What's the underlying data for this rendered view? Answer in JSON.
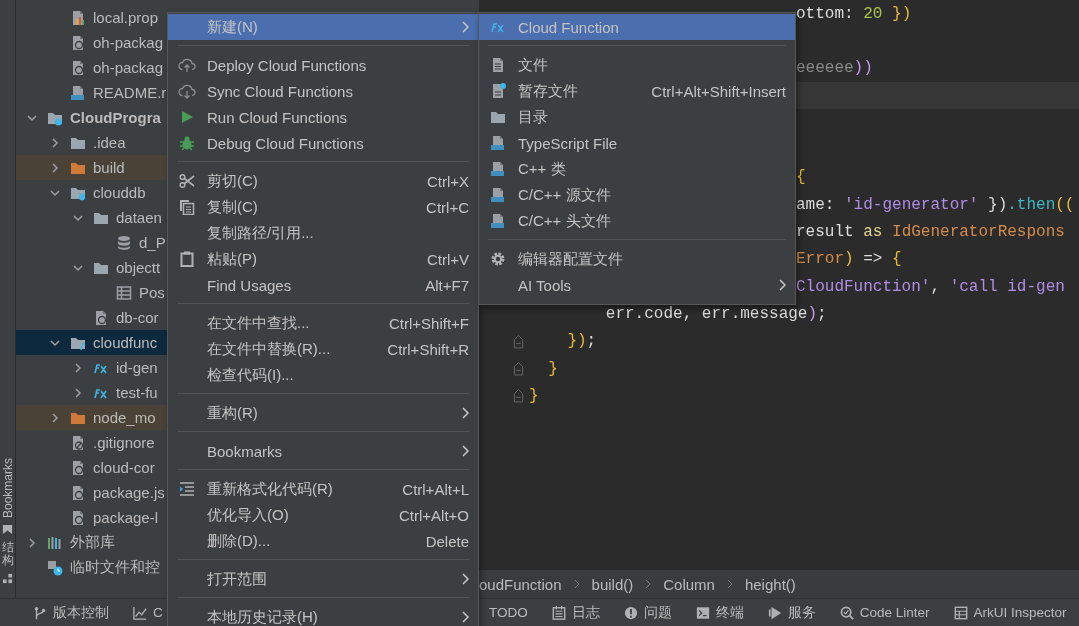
{
  "side_stripe": {
    "labels": [
      "Bookmarks",
      "结构"
    ]
  },
  "project_tree": {
    "leading_items": [
      {
        "label": "local.prop",
        "kind": "chart-file",
        "selected": false,
        "excluded": false
      },
      {
        "label": "oh-packag",
        "kind": "json-file",
        "selected": false,
        "excluded": false
      },
      {
        "label": "oh-packag",
        "kind": "json-file",
        "selected": false,
        "excluded": false
      },
      {
        "label": "README.r",
        "kind": "md-file",
        "selected": false,
        "excluded": false
      }
    ],
    "items": [
      {
        "label": "CloudProgra",
        "kind": "module",
        "expanded": true,
        "selected": false,
        "excluded": false,
        "children": [
          {
            "label": ".idea",
            "kind": "folder",
            "expanded": false,
            "selected": false,
            "excluded": false
          },
          {
            "label": "build",
            "kind": "folder",
            "expanded": false,
            "selected": false,
            "excluded": true
          },
          {
            "label": "clouddb",
            "kind": "db-folder",
            "expanded": true,
            "selected": false,
            "excluded": false,
            "children": [
              {
                "label": "dataen",
                "kind": "folder",
                "expanded": true,
                "selected": false,
                "excluded": false,
                "children": [
                  {
                    "label": "d_P",
                    "kind": "database",
                    "selected": false,
                    "excluded": false
                  }
                ]
              },
              {
                "label": "objectt",
                "kind": "folder",
                "expanded": true,
                "selected": false,
                "excluded": false,
                "children": [
                  {
                    "label": "Pos",
                    "kind": "table",
                    "selected": false,
                    "excluded": false
                  }
                ]
              },
              {
                "label": "db-cor",
                "kind": "json-file",
                "selected": false,
                "excluded": false
              }
            ]
          },
          {
            "label": "cloudfunc",
            "kind": "fn-folder",
            "expanded": true,
            "selected": true,
            "excluded": false,
            "children": [
              {
                "label": "id-gen",
                "kind": "function",
                "expanded": false,
                "selected": false,
                "excluded": false
              },
              {
                "label": "test-fu",
                "kind": "function",
                "expanded": false,
                "selected": false,
                "excluded": false
              }
            ]
          },
          {
            "label": "node_mo",
            "kind": "folder",
            "expanded": false,
            "selected": false,
            "excluded": true
          },
          {
            "label": ".gitignore",
            "kind": "ignore-file",
            "selected": false,
            "excluded": false
          },
          {
            "label": "cloud-cor",
            "kind": "json-file",
            "selected": false,
            "excluded": false
          },
          {
            "label": "package.js",
            "kind": "json-file",
            "selected": false,
            "excluded": false
          },
          {
            "label": "package-l",
            "kind": "json-file",
            "selected": false,
            "excluded": false
          }
        ]
      },
      {
        "label": "外部库",
        "kind": "library",
        "expanded": false,
        "selected": false,
        "excluded": false
      },
      {
        "label": "临时文件和控",
        "kind": "scratch",
        "selected": false,
        "excluded": false
      }
    ]
  },
  "editor": {
    "lines": [
      {
        "kind": "code",
        "cut": true,
        "tokens": [
          {
            "text": "ottom: ",
            "kind": "plain"
          },
          {
            "text": "20",
            "kind": "number"
          },
          {
            "text": " })",
            "kind": "bracket"
          }
        ]
      },
      {
        "kind": "code"
      },
      {
        "kind": "code",
        "cut": true,
        "tokens": [
          {
            "text": "eeeeee",
            "kind": "muted"
          },
          {
            "text": "))",
            "kind": "paren"
          }
        ]
      },
      {
        "kind": "current-line"
      },
      {
        "kind": "code"
      },
      {
        "kind": "code"
      },
      {
        "kind": "code",
        "cut": true,
        "tokens": [
          {
            "text": "{",
            "kind": "bracket"
          }
        ]
      },
      {
        "kind": "code",
        "cut": true,
        "tokens": [
          {
            "text": "ame: ",
            "kind": "plain"
          },
          {
            "text": "'id-generator'",
            "kind": "string"
          },
          {
            "text": " })",
            "kind": "plain"
          },
          {
            "text": ".then",
            "kind": "method"
          },
          {
            "text": "((",
            "kind": "bracket"
          }
        ]
      },
      {
        "kind": "code",
        "cut": true,
        "tokens": [
          {
            "text": "result ",
            "kind": "plain"
          },
          {
            "text": "as",
            "kind": "keyword"
          },
          {
            "text": " IdGeneratorRespons",
            "kind": "type"
          }
        ]
      },
      {
        "kind": "code",
        "cut": true,
        "tokens": [
          {
            "text": "Error",
            "kind": "type"
          },
          {
            "text": ")",
            "kind": "bracket"
          },
          {
            "text": " => ",
            "kind": "plain"
          },
          {
            "text": "{",
            "kind": "bracket"
          }
        ]
      },
      {
        "kind": "code",
        "cut": true,
        "tokens": [
          {
            "text": "CloudFunction'",
            "kind": "string"
          },
          {
            "text": ", ",
            "kind": "plain"
          },
          {
            "text": "'call id-gen",
            "kind": "string"
          }
        ]
      },
      {
        "kind": "code",
        "cut": false,
        "tokens": [
          {
            "text": "        err.code, err.message",
            "kind": "plain"
          },
          {
            "text": ")",
            "kind": "paren"
          },
          {
            "text": ";",
            "kind": "plain"
          }
        ]
      },
      {
        "kind": "code",
        "cut": false,
        "fold_marker": true,
        "tokens": [
          {
            "text": "    })",
            "kind": "bracket"
          },
          {
            "text": ";",
            "kind": "plain"
          }
        ]
      },
      {
        "kind": "code",
        "cut": false,
        "fold_marker": true,
        "tokens": [
          {
            "text": "  }",
            "kind": "bracket"
          }
        ]
      },
      {
        "kind": "code",
        "cut": false,
        "fold_marker": true,
        "tokens": [
          {
            "text": "}",
            "kind": "bracket"
          }
        ]
      }
    ]
  },
  "breadcrumbs": [
    "oudFunction",
    "build()",
    "Column",
    "height()"
  ],
  "tool_windows": [
    {
      "label": "版本控制"
    },
    {
      "label": "C"
    },
    {
      "label": "TODO"
    },
    {
      "label": "日志"
    },
    {
      "label": "问题"
    },
    {
      "label": "终端"
    },
    {
      "label": "服务"
    },
    {
      "label": "Code Linter"
    },
    {
      "label": "ArkUI Inspector"
    }
  ],
  "context_menu": {
    "items": [
      {
        "kind": "item",
        "label": "新建(N)",
        "selected": true,
        "submenu": true
      },
      {
        "kind": "separator"
      },
      {
        "kind": "item",
        "label": "Deploy Cloud Functions",
        "selected": false
      },
      {
        "kind": "item",
        "label": "Sync Cloud Functions",
        "selected": false
      },
      {
        "kind": "item",
        "label": "Run Cloud Functions",
        "selected": false
      },
      {
        "kind": "item",
        "label": "Debug Cloud Functions",
        "selected": false
      },
      {
        "kind": "separator"
      },
      {
        "kind": "item",
        "label": "剪切(C)",
        "shortcut": "Ctrl+X",
        "selected": false
      },
      {
        "kind": "item",
        "label": "复制(C)",
        "shortcut": "Ctrl+C",
        "selected": false
      },
      {
        "kind": "item",
        "label": "复制路径/引用...",
        "selected": false
      },
      {
        "kind": "item",
        "label": "粘贴(P)",
        "shortcut": "Ctrl+V",
        "selected": false
      },
      {
        "kind": "item",
        "label": "Find Usages",
        "shortcut": "Alt+F7",
        "selected": false
      },
      {
        "kind": "separator"
      },
      {
        "kind": "item",
        "label": "在文件中查找...",
        "shortcut": "Ctrl+Shift+F",
        "selected": false
      },
      {
        "kind": "item",
        "label": "在文件中替换(R)...",
        "shortcut": "Ctrl+Shift+R",
        "selected": false
      },
      {
        "kind": "item",
        "label": "检查代码(I)...",
        "selected": false
      },
      {
        "kind": "separator"
      },
      {
        "kind": "item",
        "label": "重构(R)",
        "selected": false,
        "submenu": true
      },
      {
        "kind": "separator"
      },
      {
        "kind": "item",
        "label": "Bookmarks",
        "selected": false,
        "submenu": true
      },
      {
        "kind": "separator"
      },
      {
        "kind": "item",
        "label": "重新格式化代码(R)",
        "shortcut": "Ctrl+Alt+L",
        "selected": false
      },
      {
        "kind": "item",
        "label": "优化导入(O)",
        "shortcut": "Ctrl+Alt+O",
        "selected": false
      },
      {
        "kind": "item",
        "label": "删除(D)...",
        "shortcut": "Delete",
        "selected": false
      },
      {
        "kind": "separator"
      },
      {
        "kind": "item",
        "label": "打开范围",
        "selected": false,
        "submenu": true
      },
      {
        "kind": "separator"
      },
      {
        "kind": "item",
        "label": "本地历史记录(H)",
        "selected": false,
        "submenu": true
      }
    ]
  },
  "submenu": {
    "items": [
      {
        "kind": "item",
        "label": "Cloud Function",
        "selected": true
      },
      {
        "kind": "separator"
      },
      {
        "kind": "item",
        "label": "文件",
        "selected": false
      },
      {
        "kind": "item",
        "label": "暂存文件",
        "shortcut": "Ctrl+Alt+Shift+Insert",
        "selected": false
      },
      {
        "kind": "item",
        "label": "目录",
        "selected": false
      },
      {
        "kind": "item",
        "label": "TypeScript File",
        "selected": false
      },
      {
        "kind": "item",
        "label": "C++ 类",
        "selected": false
      },
      {
        "kind": "item",
        "label": "C/C++ 源文件",
        "selected": false
      },
      {
        "kind": "item",
        "label": "C/C++ 头文件",
        "selected": false
      },
      {
        "kind": "separator"
      },
      {
        "kind": "item",
        "label": "编辑器配置文件",
        "selected": false
      },
      {
        "kind": "item",
        "label": "AI Tools",
        "selected": false,
        "submenu": true
      }
    ]
  }
}
